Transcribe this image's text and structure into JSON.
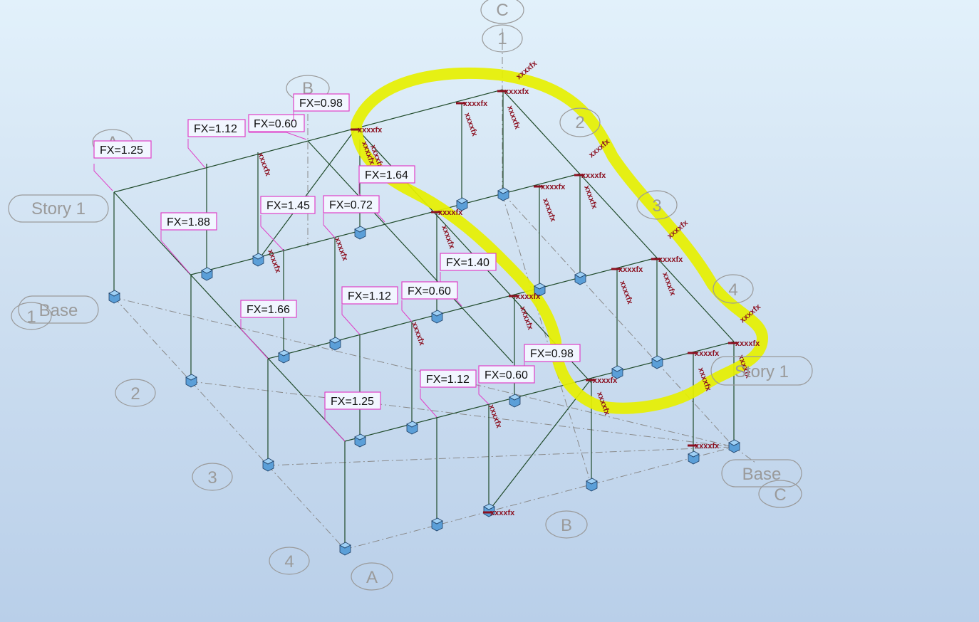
{
  "colors": {
    "frame": "#1f4a2a",
    "grid": "#8a8a8a",
    "bubble_stroke": "#9a9a9a",
    "bubble_text": "#9a9a9a",
    "support_fill": "#5b9fd8",
    "support_stroke": "#1d3f66",
    "tag_border": "#e040c8",
    "tag_fill": "#f1f6ff",
    "release_mark": "#8b1020",
    "highlight": "#e6f000"
  },
  "grid_bubbles": {
    "top_C": "C",
    "top_1": "1",
    "top_B": "B",
    "top_A": "A",
    "right_2": "2",
    "right_3": "3",
    "right_4": "4",
    "left_1": "1",
    "left_2": "2",
    "left_3": "3",
    "left_4": "4",
    "bottom_A": "A",
    "bottom_B": "B",
    "bottom_C": "C"
  },
  "story_labels": {
    "left_story": "Story 1",
    "left_base": "Base",
    "right_story": "Story 1",
    "right_base": "Base"
  },
  "force_tags": {
    "t1": "FX=1.25",
    "t2": "FX=1.12",
    "t3": "FX=0.60",
    "t4": "FX=0.98",
    "t5": "FX=1.64",
    "t6": "FX=1.88",
    "t7": "FX=1.45",
    "t8": "FX=0.72",
    "t9": "FX=1.40",
    "t10": "FX=1.12",
    "t11": "FX=0.60",
    "t12": "FX=1.66",
    "t13": "FX=0.98",
    "t14": "FX=1.12",
    "t15": "FX=0.60",
    "t16": "FX=1.25"
  },
  "release_label": "xxxxfx"
}
